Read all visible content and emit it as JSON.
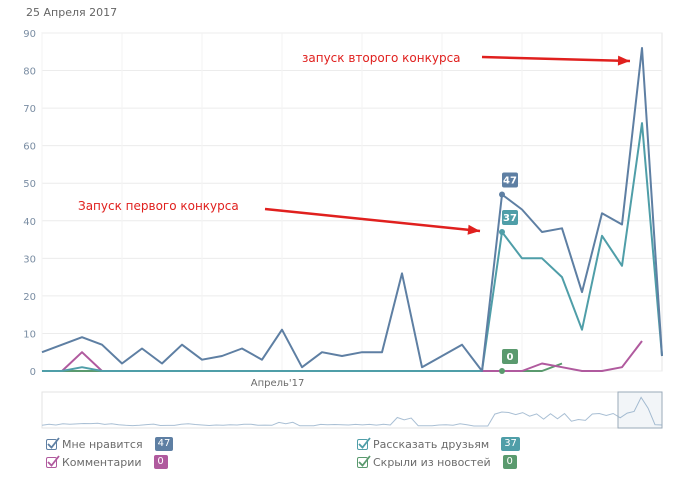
{
  "date_label": "25 Апреля 2017",
  "chart_data": {
    "type": "line",
    "ylim": [
      0,
      90
    ],
    "yticks": [
      "0",
      "10",
      "20",
      "30",
      "40",
      "50",
      "60",
      "70",
      "80",
      "90"
    ],
    "xaxis_label": "Апрель'17",
    "grid": true,
    "x": [
      1,
      2,
      3,
      4,
      5,
      6,
      7,
      8,
      9,
      10,
      11,
      12,
      13,
      14,
      15,
      16,
      17,
      18,
      19,
      20,
      21,
      22,
      23,
      24,
      25,
      26,
      27,
      28,
      29,
      30
    ],
    "series": [
      {
        "name": "Мне нравится",
        "color": "#5e7fa3",
        "values": [
          5,
          7,
          9,
          7,
          2,
          6,
          2,
          7,
          3,
          4,
          6,
          3,
          11,
          1,
          5,
          4,
          5,
          5,
          26,
          1,
          4,
          7,
          0,
          47,
          43,
          37,
          38,
          21,
          42,
          39,
          86,
          4
        ]
      },
      {
        "name": "Рассказать друзьям",
        "color": "#4f9ea8",
        "values": [
          0,
          0,
          1,
          0,
          0,
          0,
          0,
          0,
          0,
          0,
          0,
          0,
          0,
          0,
          0,
          0,
          0,
          0,
          0,
          0,
          0,
          0,
          0,
          37,
          30,
          30,
          25,
          11,
          36,
          28,
          66,
          4
        ]
      },
      {
        "name": "Комментарии",
        "color": "#b05a9e",
        "values": [
          0,
          0,
          5,
          0,
          0,
          0,
          0,
          0,
          0,
          0,
          0,
          0,
          0,
          0,
          0,
          0,
          0,
          0,
          0,
          0,
          0,
          0,
          0,
          0,
          0,
          2,
          1,
          0,
          0,
          1,
          8,
          null
        ]
      },
      {
        "name": "Скрыли из новостей",
        "color": "#5a9a6e",
        "values": [
          0,
          0,
          0,
          0,
          0,
          0,
          0,
          0,
          0,
          0,
          0,
          0,
          0,
          0,
          0,
          0,
          0,
          0,
          0,
          0,
          0,
          0,
          0,
          0,
          0,
          0,
          2,
          null,
          null,
          null,
          null,
          null
        ]
      }
    ],
    "tooltips": [
      {
        "text": "47",
        "series": 0,
        "index": 23,
        "color": "#5e7fa3"
      },
      {
        "text": "37",
        "series": 1,
        "index": 23,
        "color": "#4f9ea8"
      },
      {
        "text": "0",
        "series": 3,
        "index": 23,
        "color": "#5a9a6e"
      }
    ],
    "annotations": [
      {
        "text": "запуск второго конкурса",
        "color": "#e0201e"
      },
      {
        "text": "Запуск первого конкурса",
        "color": "#e0201e"
      }
    ]
  },
  "legend": [
    {
      "label": "Мне нравится",
      "count": "47",
      "color": "#5e7fa3"
    },
    {
      "label": "Рассказать друзьям",
      "count": "37",
      "color": "#4f9ea8"
    },
    {
      "label": "Комментарии",
      "count": "0",
      "color": "#b05a9e"
    },
    {
      "label": "Скрыли из новостей",
      "count": "0",
      "color": "#5a9a6e"
    }
  ]
}
